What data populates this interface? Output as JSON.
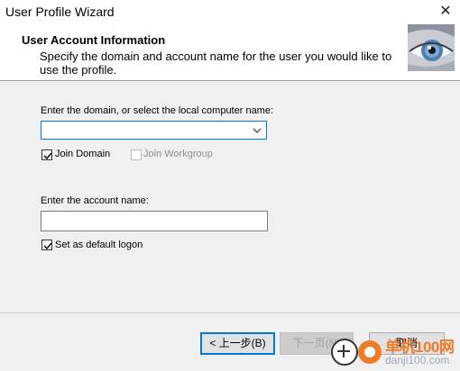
{
  "window": {
    "title": "User Profile Wizard"
  },
  "header": {
    "title": "User Account Information",
    "subtitle": "Specify the domain and account name for the user you would like to use the profile."
  },
  "domain": {
    "label": "Enter the domain, or select the local computer name:",
    "value": ""
  },
  "join_domain": {
    "label": "Join Domain",
    "checked": true
  },
  "join_workgroup": {
    "label": "Join Workgroup",
    "checked": false,
    "enabled": false
  },
  "account": {
    "label": "Enter the account name:",
    "value": ""
  },
  "default_logon": {
    "label": "Set as default logon",
    "checked": true
  },
  "buttons": {
    "back": "< 上一步(B)",
    "next": "下一页(N)",
    "cancel": "取消"
  },
  "watermark": {
    "text": "单机100网",
    "url": "danji100.com"
  },
  "colors": {
    "focus_border": "#0078d7",
    "watermark_orange": "#f07a2a"
  }
}
